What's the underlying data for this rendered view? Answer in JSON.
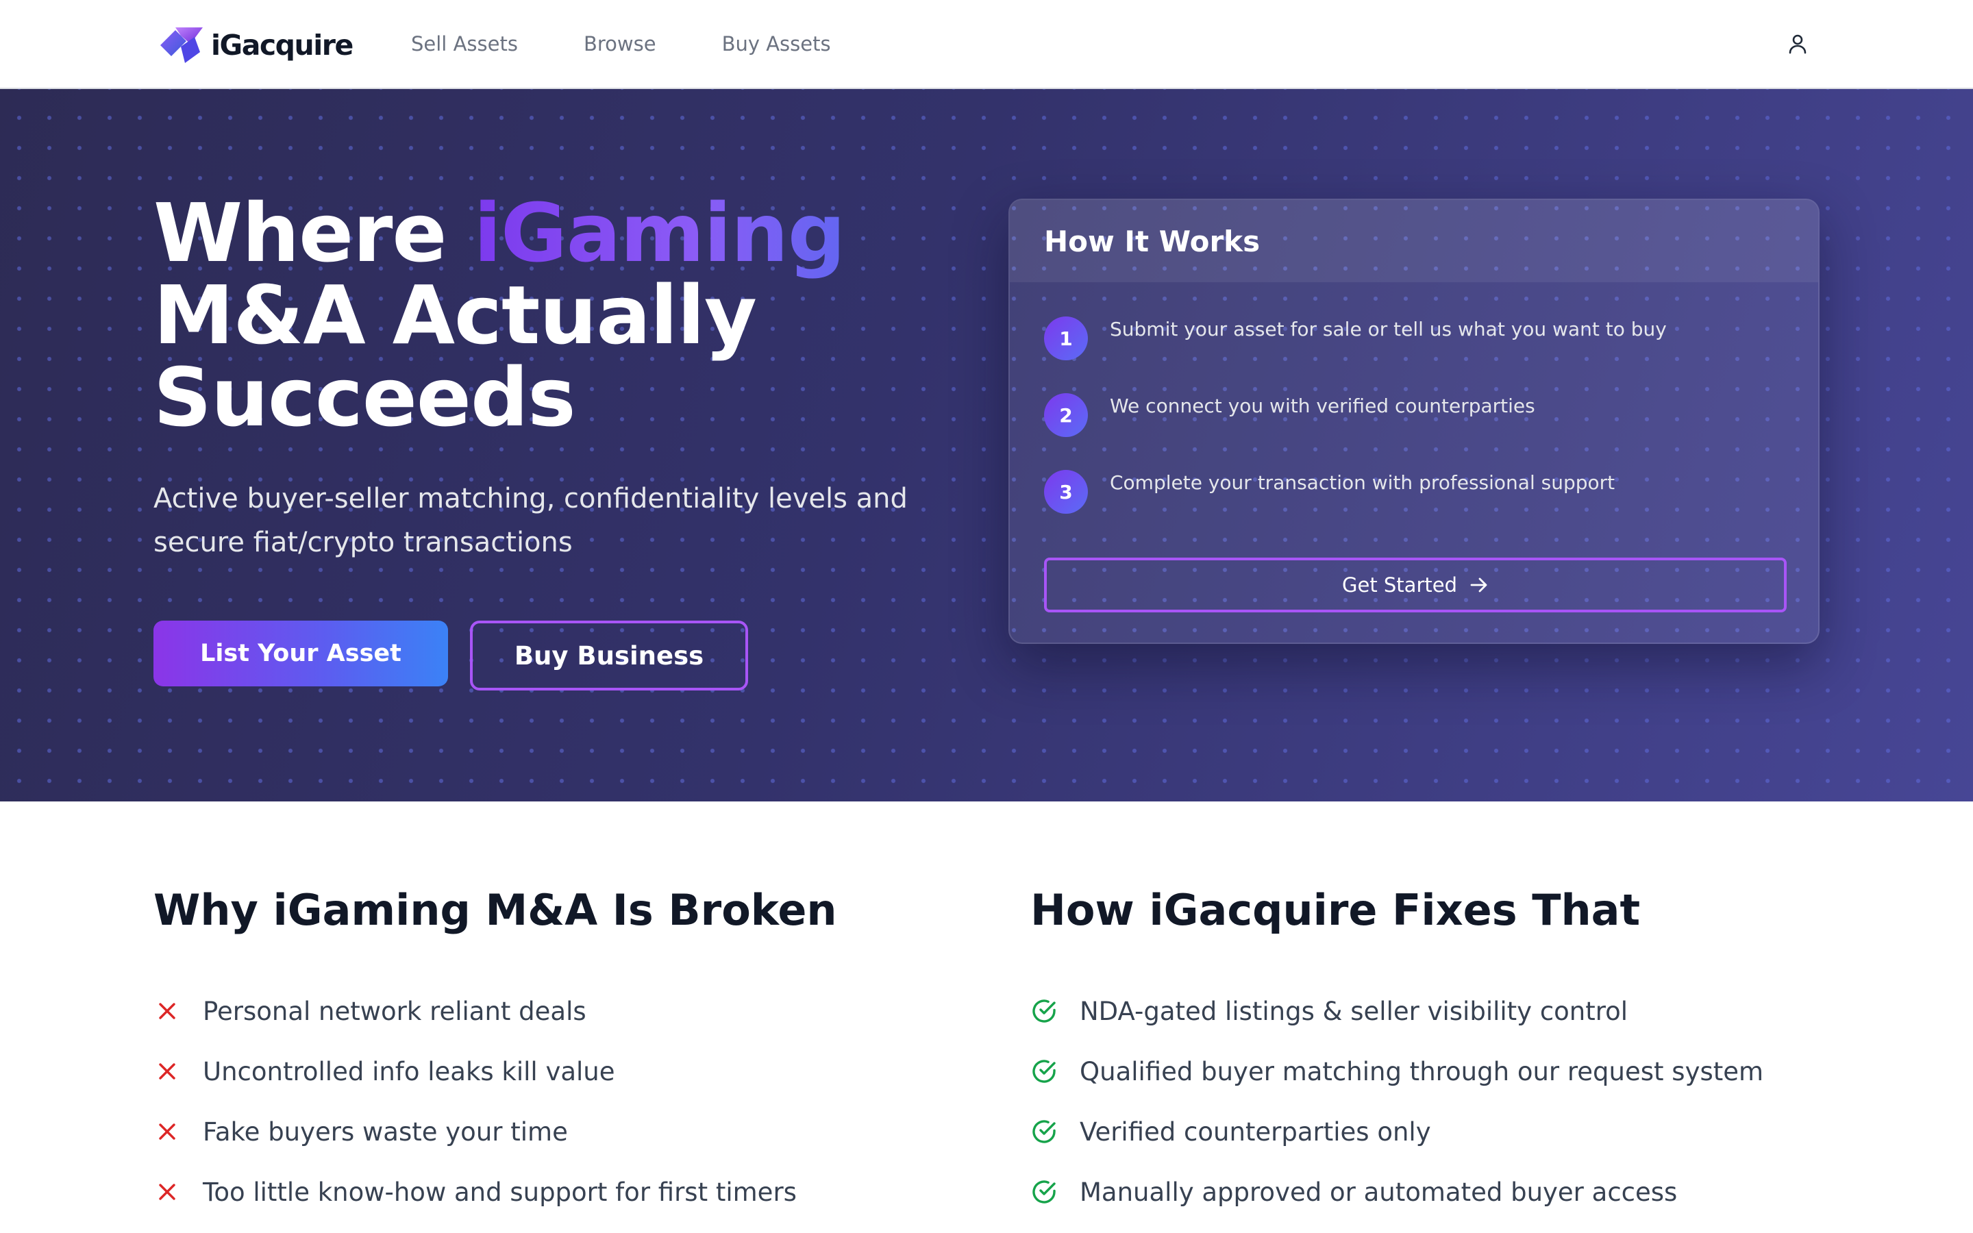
{
  "header": {
    "logo_text": "iGacquire",
    "nav": [
      "Sell Assets",
      "Browse",
      "Buy Assets"
    ],
    "user_icon": "user-icon"
  },
  "hero": {
    "title_before": "Where ",
    "title_accent": "iGaming",
    "title_after": "M&A Actually Succeeds",
    "subtitle": "Active buyer-seller matching, confidentiality levels and secure fiat/crypto transactions",
    "primary_button": "List Your Asset",
    "secondary_button": "Buy Business"
  },
  "how_it_works": {
    "title": "How It Works",
    "steps": [
      {
        "num": "1",
        "text": "Submit your asset for sale or tell us what you want to buy"
      },
      {
        "num": "2",
        "text": "We connect you with verified counterparties"
      },
      {
        "num": "3",
        "text": "Complete your transaction with professional support"
      }
    ],
    "button": "Get Started",
    "button_icon": "arrow-right-icon"
  },
  "broken": {
    "title": "Why iGaming M&A Is Broken",
    "icon": "x-icon",
    "icon_color": "#dc2626",
    "items": [
      "Personal network reliant deals",
      "Uncontrolled info leaks kill value",
      "Fake buyers waste your time",
      "Too little know-how and support for first timers"
    ]
  },
  "fixes": {
    "title": "How iGacquire Fixes That",
    "icon": "check-circle-icon",
    "icon_color": "#16a34a",
    "items": [
      "NDA-gated listings & seller visibility control",
      "Qualified buyer matching through our request system",
      "Verified counterparties only",
      "Manually approved or automated buyer access"
    ]
  },
  "colors": {
    "brand_purple": "#7c3aed",
    "brand_blue": "#3b82f6",
    "hero_bg": "#33326b"
  }
}
